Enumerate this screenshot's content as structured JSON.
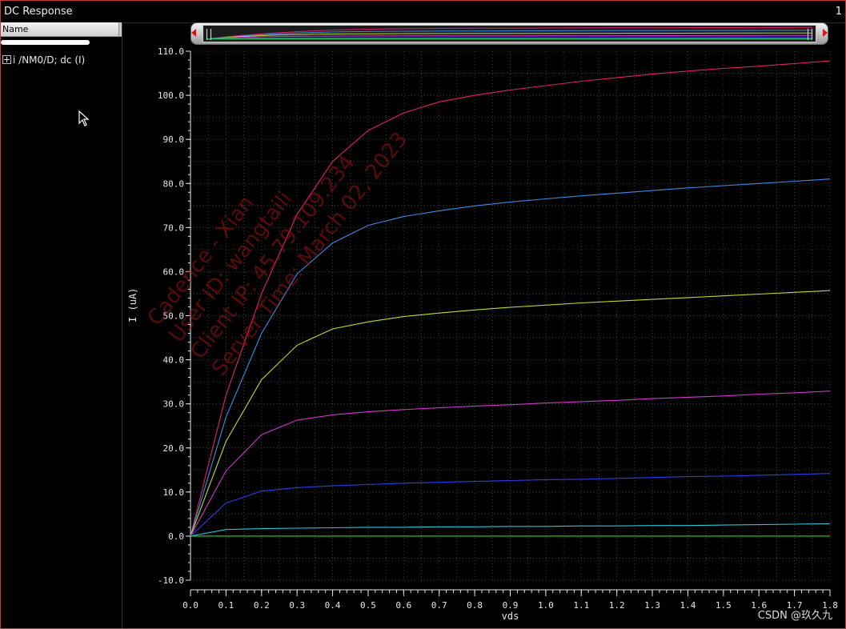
{
  "window": {
    "title": "DC Response",
    "subwindow_number": "1"
  },
  "sidebar": {
    "column_header": "Name",
    "trace_label": "i /NM0/D; dc (I)"
  },
  "watermark": {
    "lines": [
      "Cadence - Xian",
      "User ID: wangtaili",
      "Client IP: 45.79.109.234",
      "Server Time: March 02, 2023"
    ]
  },
  "credit": "CSDN @玖久九",
  "colors": {
    "background": "#000000",
    "grid": "#3c3c3c",
    "axis_text": "#e6e6e6",
    "frame_border": "#c23a3a"
  },
  "chart_data": {
    "type": "line",
    "xlabel": "vds",
    "ylabel": "I (uA)",
    "xlim": [
      0.0,
      1.8
    ],
    "ylim": [
      -10.0,
      110.0
    ],
    "x_ticks": [
      "0.0",
      "0.1",
      "0.2",
      "0.3",
      "0.4",
      "0.5",
      "0.6",
      "0.7",
      "0.8",
      "0.9",
      "1.0",
      "1.1",
      "1.2",
      "1.3",
      "1.4",
      "1.5",
      "1.6",
      "1.7",
      "1.8"
    ],
    "y_ticks": [
      "-10.0",
      "0.0",
      "10.0",
      "20.0",
      "30.0",
      "40.0",
      "50.0",
      "60.0",
      "70.0",
      "80.0",
      "90.0",
      "100.0",
      "110.0"
    ],
    "grid": true,
    "x": [
      0.0,
      0.1,
      0.2,
      0.3,
      0.4,
      0.5,
      0.6,
      0.7,
      0.8,
      0.9,
      1.0,
      1.1,
      1.2,
      1.3,
      1.4,
      1.5,
      1.6,
      1.7,
      1.8
    ],
    "series": [
      {
        "color": "#e0206e",
        "values": [
          0.0,
          32.0,
          55.0,
          73.0,
          85.0,
          92.0,
          96.0,
          98.5,
          100.0,
          101.2,
          102.2,
          103.2,
          104.0,
          104.8,
          105.5,
          106.1,
          106.6,
          107.2,
          107.8
        ]
      },
      {
        "color": "#3f8be5",
        "values": [
          0.0,
          27.0,
          46.0,
          59.5,
          66.5,
          70.5,
          72.5,
          73.8,
          74.9,
          75.8,
          76.5,
          77.2,
          77.8,
          78.4,
          79.0,
          79.5,
          80.0,
          80.5,
          81.0
        ]
      },
      {
        "color": "#b8e02b",
        "values": [
          0.0,
          21.5,
          35.5,
          43.3,
          47.0,
          48.6,
          49.8,
          50.6,
          51.3,
          51.9,
          52.4,
          52.9,
          53.3,
          53.7,
          54.1,
          54.5,
          54.9,
          55.3,
          55.7
        ]
      },
      {
        "color": "#d436d0",
        "values": [
          0.0,
          14.8,
          23.0,
          26.3,
          27.5,
          28.2,
          28.7,
          29.1,
          29.5,
          29.8,
          30.2,
          30.5,
          30.8,
          31.2,
          31.5,
          31.8,
          32.2,
          32.5,
          32.9
        ]
      },
      {
        "color": "#2b3fe8",
        "values": [
          0.0,
          7.5,
          10.2,
          11.0,
          11.4,
          11.7,
          12.0,
          12.2,
          12.4,
          12.6,
          12.8,
          12.9,
          13.1,
          13.3,
          13.5,
          13.6,
          13.8,
          14.0,
          14.2
        ]
      },
      {
        "color": "#27c6d9",
        "values": [
          0.0,
          1.5,
          1.7,
          1.8,
          1.9,
          2.0,
          2.0,
          2.1,
          2.1,
          2.2,
          2.2,
          2.3,
          2.3,
          2.4,
          2.4,
          2.5,
          2.6,
          2.7,
          2.8
        ]
      },
      {
        "color": "#29d23a",
        "values": [
          0.0,
          0.0,
          0.0,
          0.0,
          0.0,
          0.0,
          0.0,
          0.0,
          0.0,
          0.0,
          0.0,
          0.0,
          0.0,
          0.0,
          0.0,
          0.0,
          0.0,
          0.0,
          0.0
        ]
      }
    ]
  }
}
